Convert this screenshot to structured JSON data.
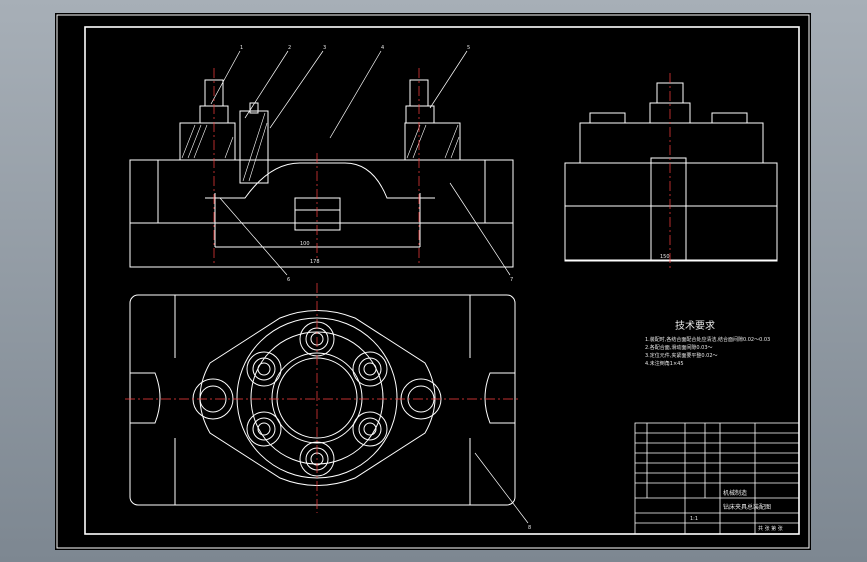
{
  "drawing": {
    "tech_requirements_title": "技术要求",
    "tech_requirements": [
      "1.装配时,各结合面配合处应清洁,结合面间隙0.02～0.03",
      "2.各配合面,滑动面间隙0.03～",
      "3.定位元件,夹紧面要平整0.02～",
      "4.未注倒角1×45"
    ],
    "dims": {
      "inner": "100",
      "overall_front": "178",
      "overall_side": "150"
    },
    "balloons": [
      "1",
      "2",
      "3",
      "4",
      "5",
      "6",
      "7",
      "8"
    ],
    "title_block": {
      "part_name": "钻床夹具总装配图",
      "school": "机械制造",
      "scale": "1:1",
      "sheet": "共 张 第 张"
    }
  },
  "colors": {
    "viewport": "#000000",
    "line": "#ffffff",
    "center": "#ff4040",
    "text": "#e8e8e8",
    "chrome": "#8a949e"
  }
}
